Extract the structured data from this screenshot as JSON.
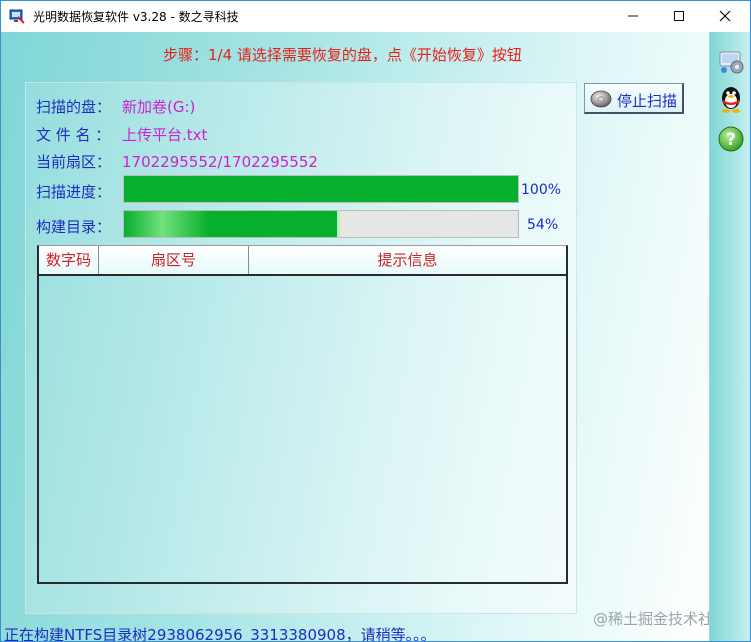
{
  "window": {
    "title": "光明数据恢复软件 v3.28 - 数之寻科技"
  },
  "step": {
    "text": "步骤：1/4 请选择需要恢复的盘，点《开始恢复》按钮"
  },
  "info": {
    "disk_label": "扫描的盘：",
    "disk_value": "新加卷(G:)",
    "file_label": "文 件 名 ：",
    "file_value": "上传平台.txt",
    "sector_label": "当前扇区：",
    "sector_value": "1702295552/1702295552"
  },
  "progress": {
    "scan_label": "扫描进度：",
    "scan_value": 100,
    "scan_text": "100%",
    "build_label": "构建目录：",
    "build_value": 54,
    "build_text": "54%"
  },
  "table": {
    "headers": [
      "数字码",
      "扇区号",
      "提示信息"
    ],
    "rows": []
  },
  "buttons": {
    "stop_scan": "停止扫描"
  },
  "sidebar_icons": [
    "network-settings-icon",
    "qq-penguin-icon",
    "help-icon"
  ],
  "status": {
    "text": "正在构建NTFS目录树2938062956_3313380908，请稍等。。。"
  },
  "watermark": {
    "text": "@稀土掘金技术社区"
  },
  "colors": {
    "step_red": "#e8201a",
    "label_blue": "#1b2ec0",
    "value_magenta": "#cc22cc",
    "progress_green": "#06b02c",
    "header_red": "#cc2222",
    "background_cyan": "#7fd6d6"
  }
}
